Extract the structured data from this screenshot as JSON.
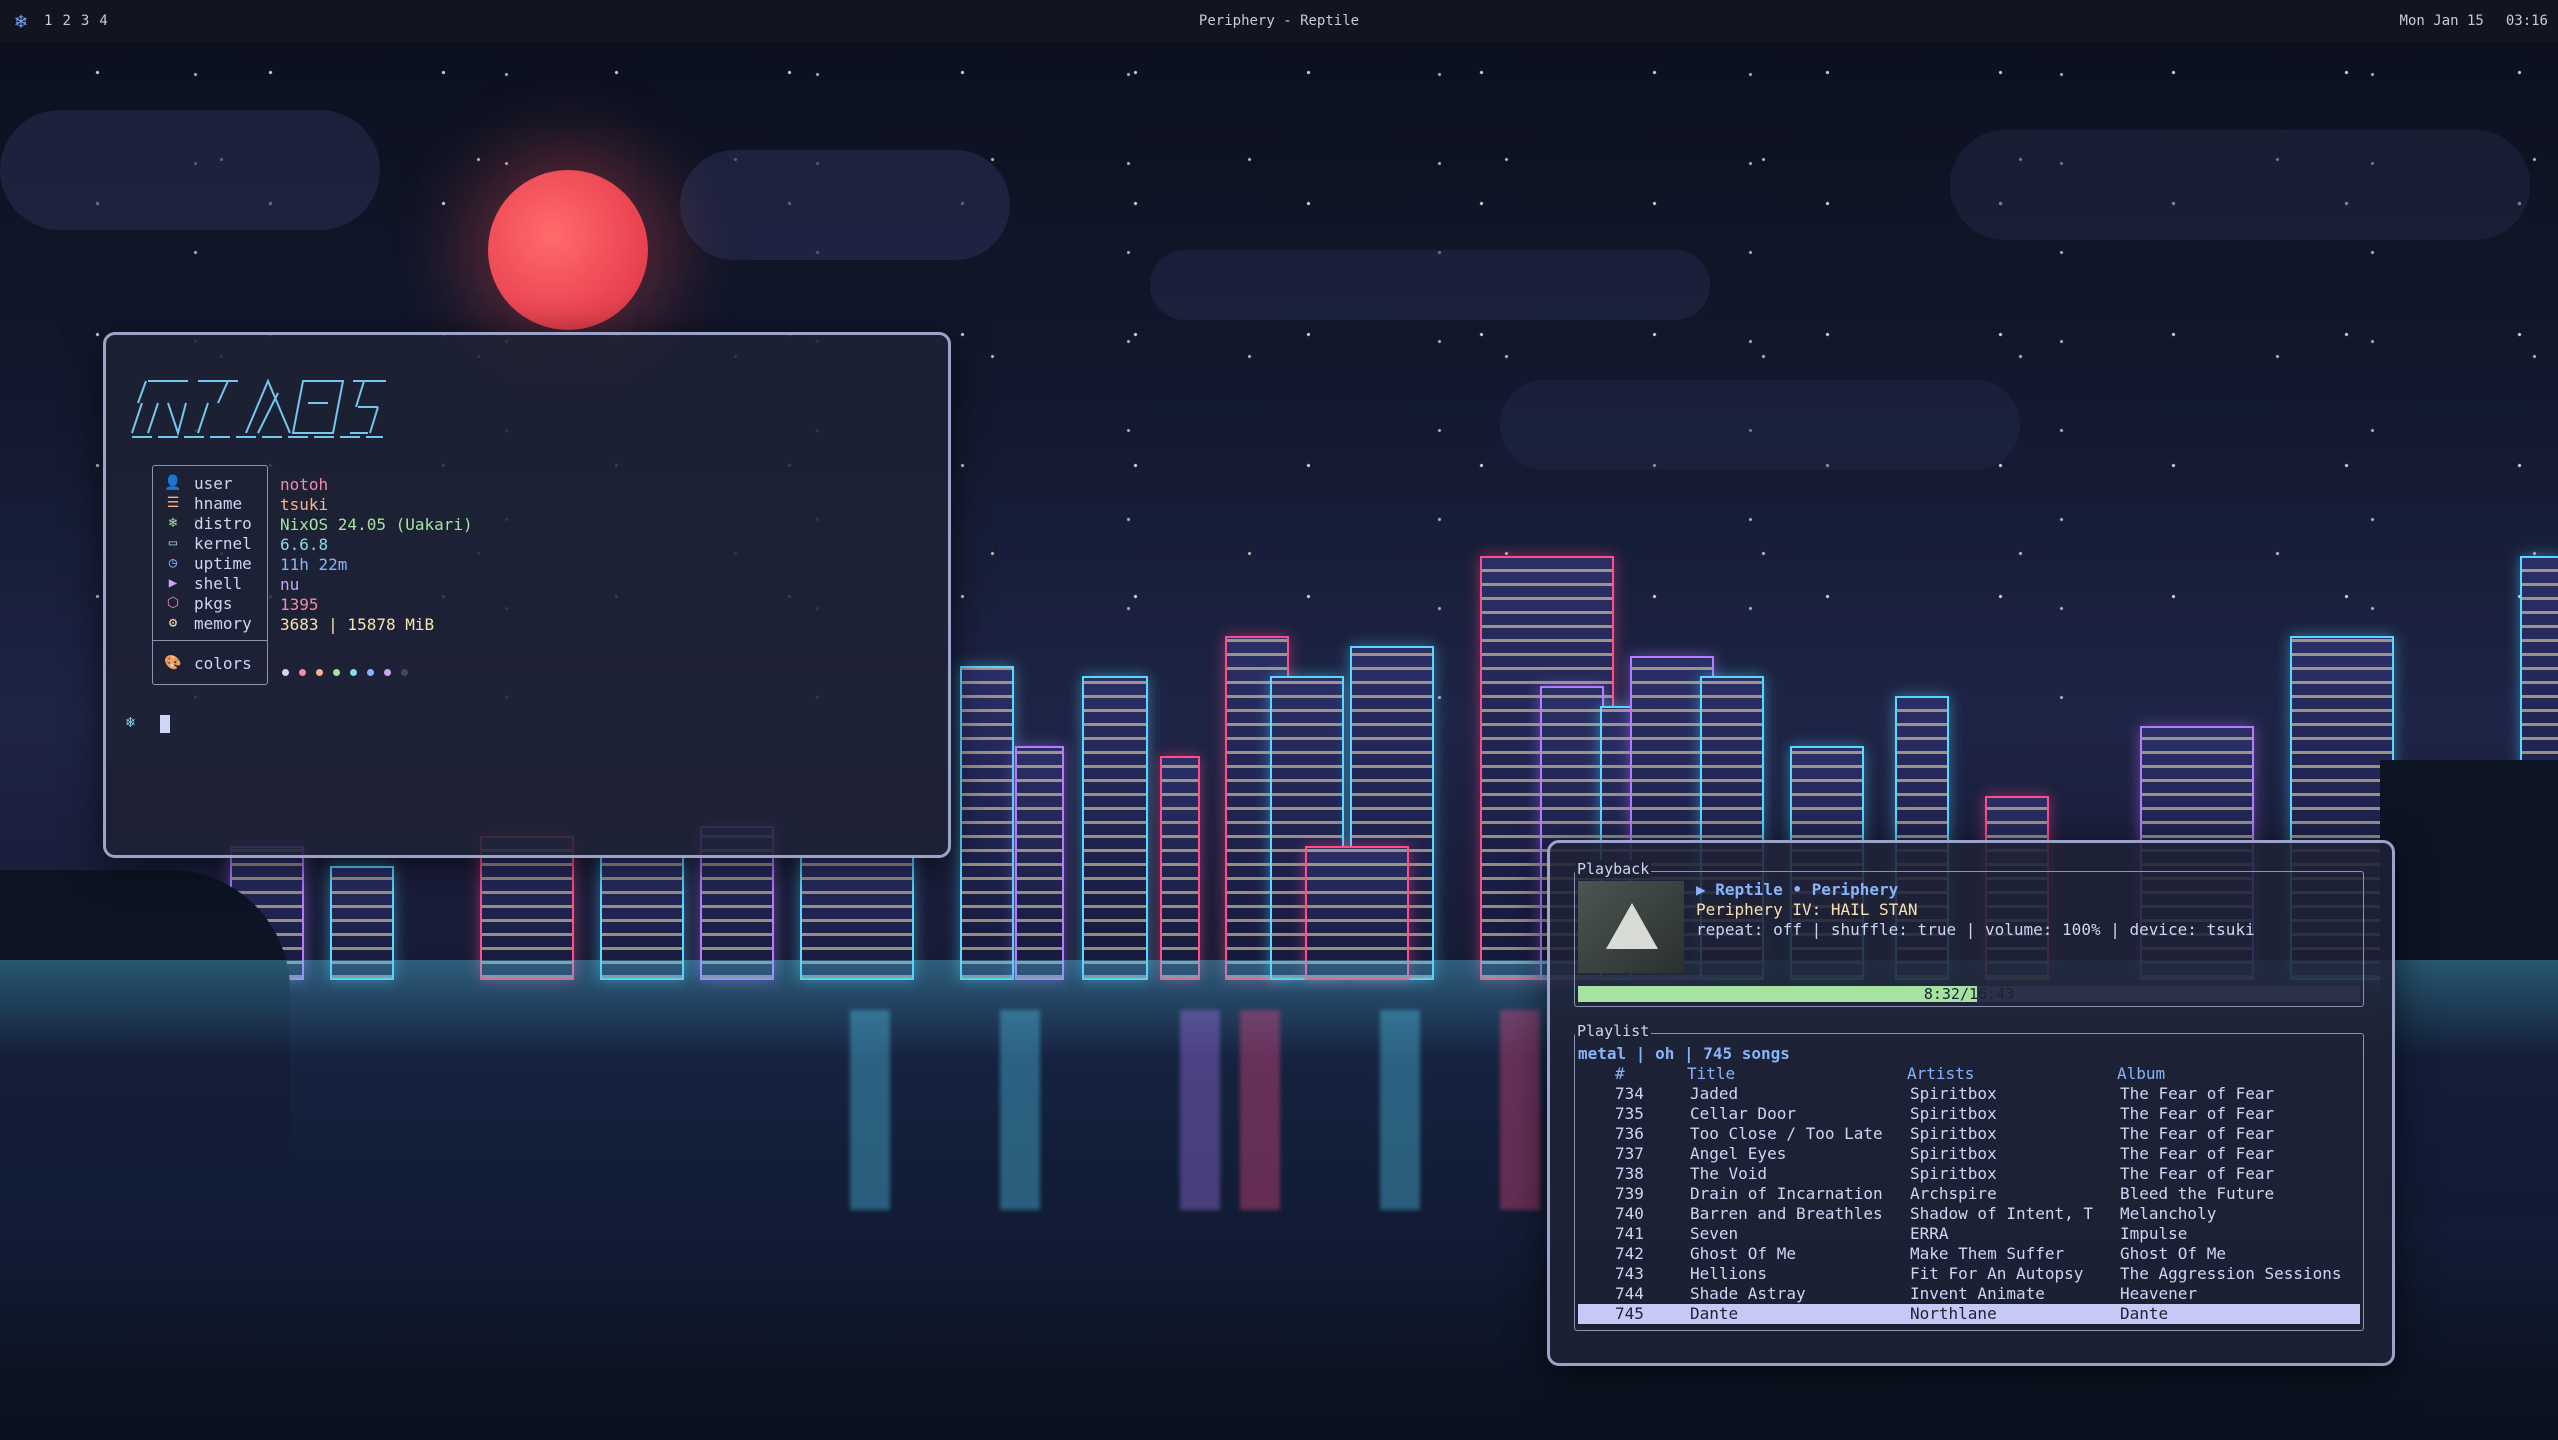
{
  "topbar": {
    "workspaces": [
      "1",
      "2",
      "3",
      "4"
    ],
    "window_title": "Periphery - Reptile",
    "date": "Mon Jan 15",
    "time": "03:16"
  },
  "fetch": {
    "rows": [
      {
        "icon": "user-icon",
        "key": "user",
        "value": "notoh",
        "color": "#f38ba8"
      },
      {
        "icon": "hostname-icon",
        "key": "hname",
        "value": "tsuki",
        "color": "#fab387"
      },
      {
        "icon": "distro-icon",
        "key": "distro",
        "value": "NixOS 24.05 (Uakari)",
        "color": "#a6e3a1"
      },
      {
        "icon": "kernel-icon",
        "key": "kernel",
        "value": "6.6.8",
        "color": "#89dceb"
      },
      {
        "icon": "uptime-icon",
        "key": "uptime",
        "value": "11h 22m",
        "color": "#89b4fa"
      },
      {
        "icon": "shell-icon",
        "key": "shell",
        "value": "nu",
        "color": "#cba6f7"
      },
      {
        "icon": "pkgs-icon",
        "key": "pkgs",
        "value": "1395",
        "color": "#f38ba8"
      },
      {
        "icon": "memory-icon",
        "key": "memory",
        "value": "3683 | 15878 MiB",
        "color": "#f9e2af"
      }
    ],
    "colors_label": "colors",
    "palette": [
      "#cdd6f4",
      "#f38ba8",
      "#fab387",
      "#a6e3a1",
      "#89dceb",
      "#89b4fa",
      "#cba6f7",
      "#45475a"
    ]
  },
  "player": {
    "playback_label": "Playback",
    "now_playing": "▶ Reptile • Periphery",
    "album": "Periphery IV: HAIL STAN",
    "status": "repeat: off | shuffle: true | volume: 100% | device: tsuki",
    "elapsed": "8:32",
    "total": "16:43",
    "progress": 0.51,
    "playlist_label": "Playlist",
    "playlist_header": "metal | oh | 745 songs",
    "columns": [
      "#",
      "Title",
      "Artists",
      "Album"
    ],
    "tracks": [
      [
        "734",
        "Jaded",
        "Spiritbox",
        "The Fear of Fear"
      ],
      [
        "735",
        "Cellar Door",
        "Spiritbox",
        "The Fear of Fear"
      ],
      [
        "736",
        "Too Close / Too Late",
        "Spiritbox",
        "The Fear of Fear"
      ],
      [
        "737",
        "Angel Eyes",
        "Spiritbox",
        "The Fear of Fear"
      ],
      [
        "738",
        "The Void",
        "Spiritbox",
        "The Fear of Fear"
      ],
      [
        "739",
        "Drain of Incarnation",
        "Archspire",
        "Bleed the Future"
      ],
      [
        "740",
        "Barren and Breathles",
        "Shadow of Intent, T",
        "Melancholy"
      ],
      [
        "741",
        "Seven",
        "ERRA",
        "Impulse"
      ],
      [
        "742",
        "Ghost Of Me",
        "Make Them Suffer",
        "Ghost Of Me"
      ],
      [
        "743",
        "Hellions",
        "Fit For An Autopsy",
        "The Aggression Sessions"
      ],
      [
        "744",
        "Shade Astray",
        "Invent Animate",
        "Heavener"
      ],
      [
        "745",
        "Dante",
        "Northlane",
        "Dante"
      ]
    ],
    "selected_index": 11
  },
  "colors": {
    "accent": "#89b4fa",
    "progress": "#a6e3a1",
    "selection": "#c5c9f5"
  }
}
